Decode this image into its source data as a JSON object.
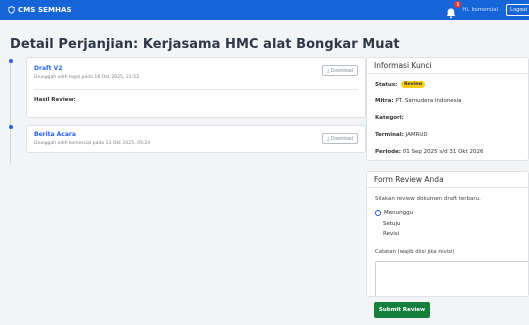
{
  "navbar": {
    "brand": "CMS SEMHAS",
    "notification_count": "1",
    "user": "Hi, komersial",
    "logout_label": "Logout"
  },
  "page": {
    "title": "Detail Perjanjian: Kerjasama HMC alat Bongkar Muat"
  },
  "timeline": [
    {
      "title": "Draft V2",
      "subtitle": "Diunggah oleh legal pada 16 Okt 2025, 21:52",
      "download_label": "⤓ Download",
      "review_label": "Hasil Review:"
    },
    {
      "title": "Berita Acara",
      "subtitle": "Diunggah oleh komersial pada 13 Okt 2025, 05:24",
      "download_label": "⤓ Download"
    }
  ],
  "info": {
    "heading": "Informasi Kunci",
    "status_label": "Status:",
    "status_value": "Review",
    "mitra_label": "Mitra:",
    "mitra_value": "PT. Samudera Indonesia",
    "kategori_label": "Kategori:",
    "kategori_value": "",
    "terminal_label": "Terminal:",
    "terminal_value": "JAMRUD",
    "periode_label": "Periode:",
    "periode_value": "01 Sep 2025 s/d 31 Okt 2026"
  },
  "review_form": {
    "heading": "Form Review Anda",
    "hint": "Silakan review dokumen draft terbaru.",
    "options": [
      "Menunggu",
      "Setuju",
      "Revisi"
    ],
    "selected": "Menunggu",
    "notes_label": "Catatan (wajib diisi jika revisi)",
    "notes_value": "",
    "submit_label": "Submit Review"
  },
  "colors": {
    "navbar": "#1565d8",
    "link": "#2563eb",
    "status_badge": "#facc15",
    "submit": "#15803d"
  }
}
